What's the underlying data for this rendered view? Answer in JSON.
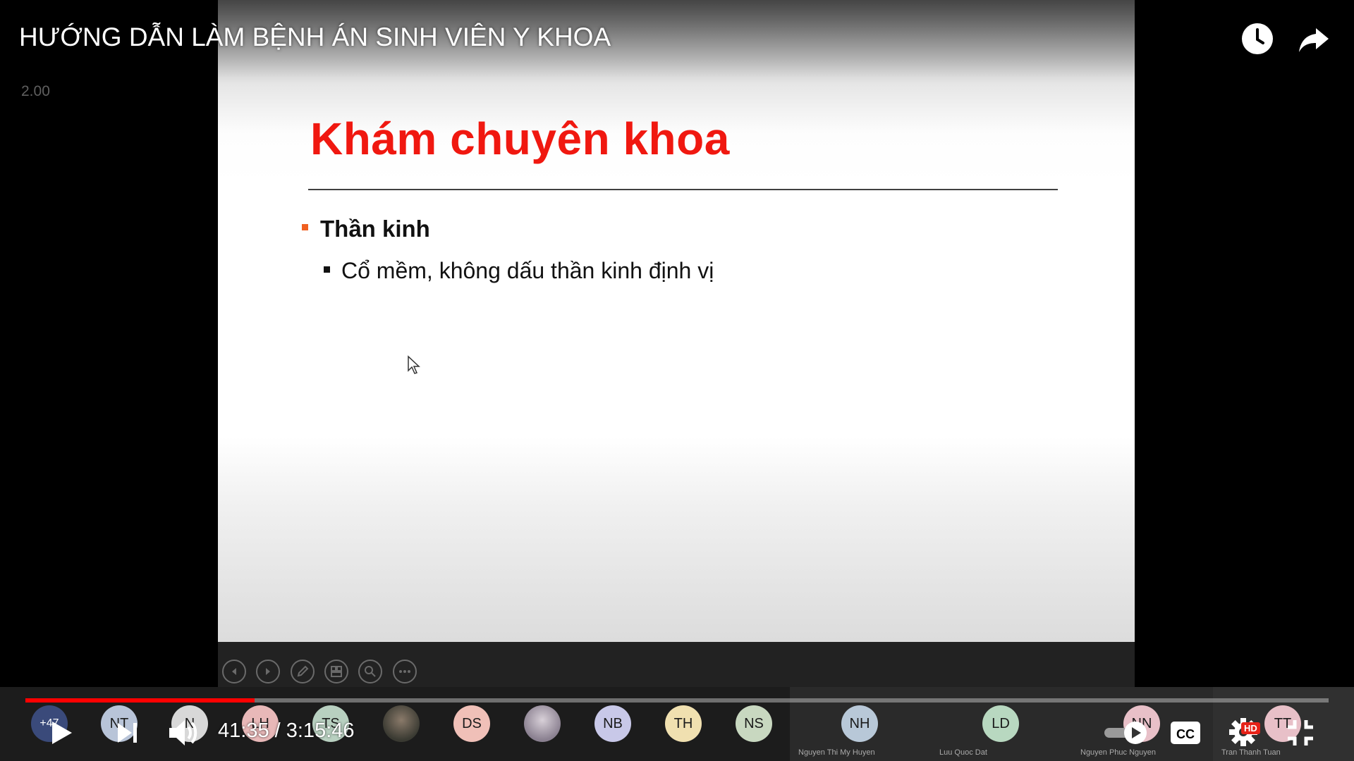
{
  "video": {
    "title": "HƯỚNG DẪN LÀM BỆNH ÁN SINH VIÊN Y KHOA",
    "speed_label": "2.00",
    "current_time": "41:35",
    "separator": " / ",
    "duration": "3:15:46",
    "progress_fraction": 0.176,
    "hd_badge": "HD"
  },
  "slide": {
    "title": "Khám chuyên khoa",
    "bullet_level1": "Thần kinh",
    "bullet_level2": "Cổ mềm, không dấu thần kinh định vị"
  },
  "participants": {
    "overflow_count": "+47",
    "avatars": [
      {
        "initials": "NT",
        "color": "#b8c4d8"
      },
      {
        "initials": "N",
        "color": "#d8d8d8"
      },
      {
        "initials": "LH",
        "color": "#e8b8b8"
      },
      {
        "initials": "TS",
        "color": "#b8d0c0"
      },
      {
        "initials": "",
        "color": "#6a5a4a",
        "photo": true
      },
      {
        "initials": "DS",
        "color": "#f0c0b8"
      },
      {
        "initials": "",
        "color": "#a8a8b8",
        "photo": true
      },
      {
        "initials": "NB",
        "color": "#c8c8e8"
      },
      {
        "initials": "TH",
        "color": "#f0e0b0"
      },
      {
        "initials": "NS",
        "color": "#c8d8c0"
      }
    ],
    "named": [
      {
        "initials": "NH",
        "name": "Nguyen Thi My Huyen",
        "color": "#b8c8d8"
      },
      {
        "initials": "LD",
        "name": "Luu Quoc Dat",
        "color": "#b8d8c0"
      },
      {
        "initials": "NN",
        "name": "Nguyen Phuc Nguyen",
        "color": "#e8c0c8"
      },
      {
        "initials": "TT",
        "name": "Tran Thanh Tuan",
        "color": "#e8c0c8"
      }
    ]
  },
  "icons": {
    "watch_later": "clock-icon",
    "share": "share-arrow-icon",
    "play": "play-icon",
    "next": "next-icon",
    "volume": "volume-icon",
    "autoplay": "autoplay-toggle-icon",
    "captions": "cc-icon",
    "settings": "gear-icon",
    "exit_fullscreen": "exit-fullscreen-icon"
  },
  "colors": {
    "progress": "#ff0000",
    "slide_title": "#f01810",
    "bullet_orange": "#f06020"
  }
}
